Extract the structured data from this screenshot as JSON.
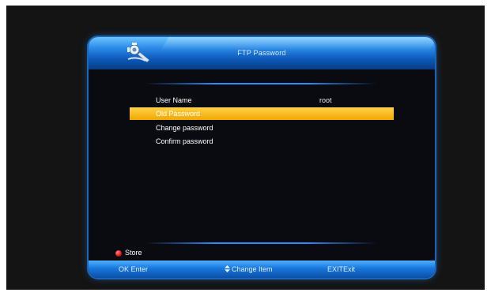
{
  "dialog": {
    "title": "FTP Password",
    "icon": "tools-icon"
  },
  "fields": [
    {
      "label": "User Name",
      "value": "root",
      "selected": false
    },
    {
      "label": "Old Password",
      "value": "",
      "selected": true
    },
    {
      "label": "Change password",
      "value": "",
      "selected": false
    },
    {
      "label": "Confirm password",
      "value": "",
      "selected": false
    }
  ],
  "store": {
    "label": "Store",
    "icon": "red-button-icon",
    "color": "#e01010"
  },
  "footer": {
    "ok_key": "OK",
    "ok_label": "Enter",
    "change_icon": "up-down-arrows-icon",
    "change_label": "Change Item",
    "exit_key": "EXIT",
    "exit_label": "Exit"
  },
  "colors": {
    "accent": "#1b66b8",
    "selection": "#f0a800",
    "background": "#0a0b10"
  }
}
